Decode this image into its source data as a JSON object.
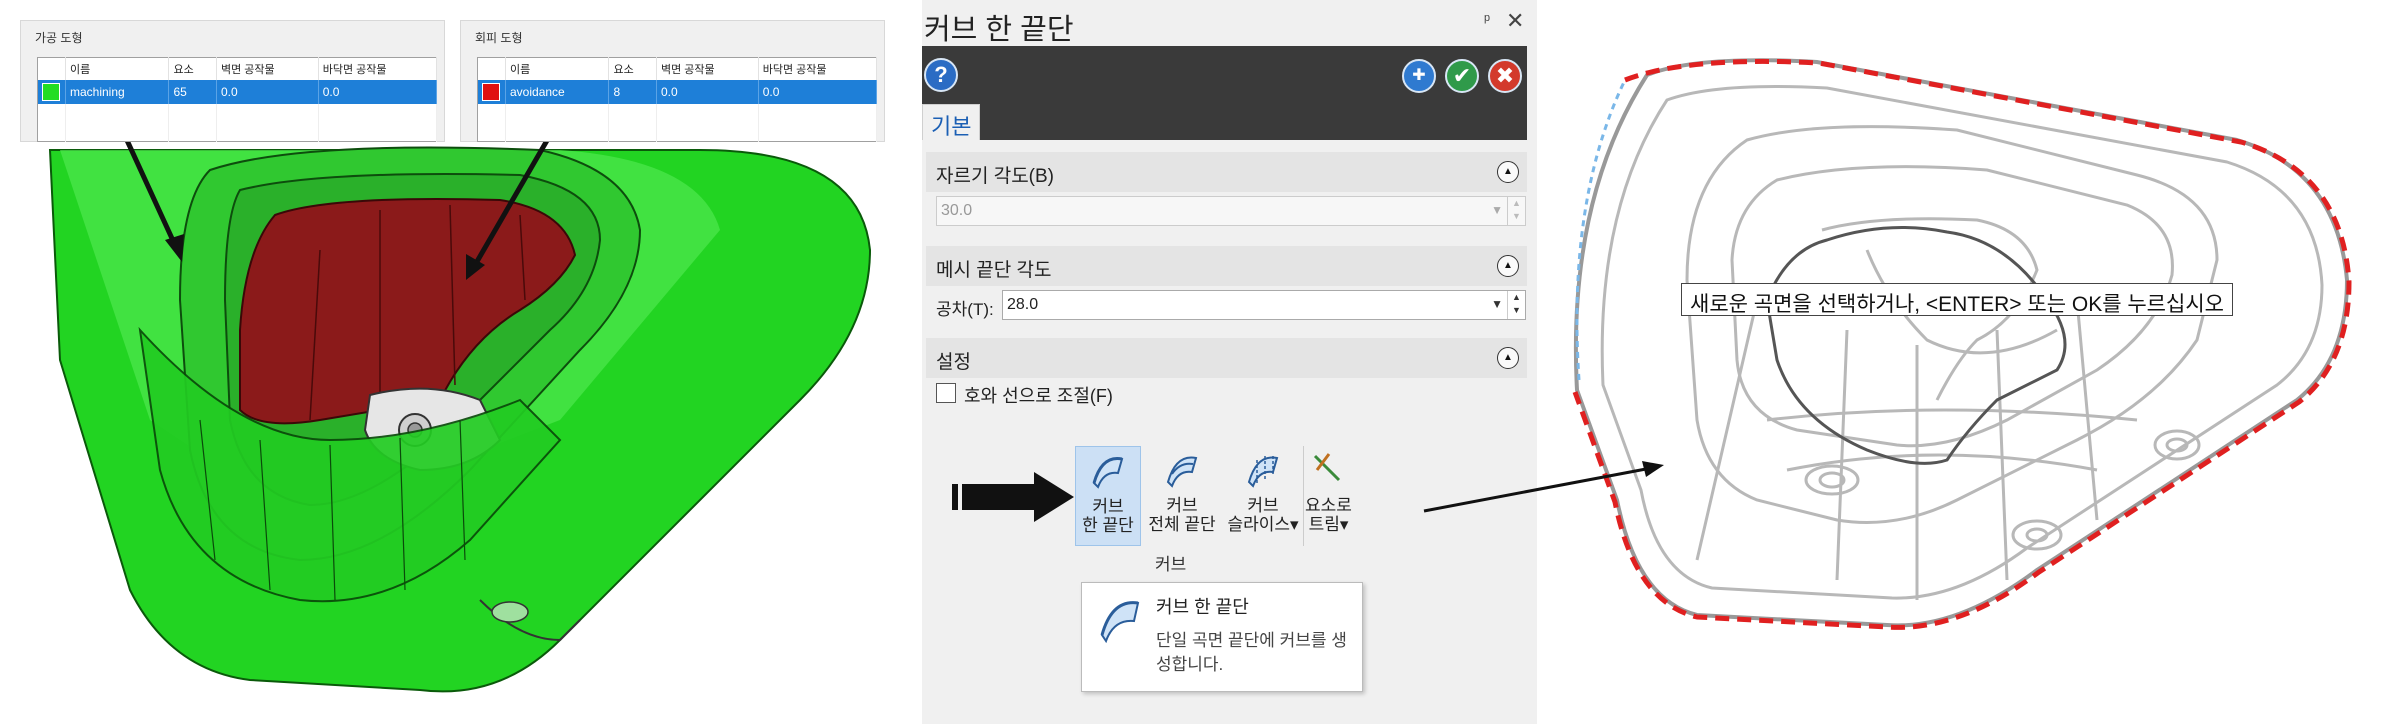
{
  "machining_panel": {
    "title": "가공 도형",
    "columns": [
      "이름",
      "요소",
      "벽면 공작물",
      "바닥면 공작물"
    ],
    "row": {
      "name": "machining",
      "elements": "65",
      "wall_stock": "0.0",
      "floor_stock": "0.0",
      "color": "#22dd22"
    }
  },
  "avoidance_panel": {
    "title": "회피 도형",
    "columns": [
      "이름",
      "요소",
      "벽면 공작물",
      "바닥면 공작물"
    ],
    "row": {
      "name": "avoidance",
      "elements": "8",
      "wall_stock": "0.0",
      "floor_stock": "0.0",
      "color": "#e01010"
    }
  },
  "dialog": {
    "title": "커브 한 끝단",
    "pin_icon": "pin-icon",
    "close_icon": "close-icon",
    "help_icon": "help-icon",
    "apply_icon": "apply-icon",
    "ok_icon": "ok-icon",
    "cancel_icon": "cancel-icon",
    "tab": "기본",
    "sections": {
      "cut_angle": {
        "header": "자르기 각도(B)",
        "value": "30.0"
      },
      "mesh_edge_angle": {
        "header": "메시 끝단 각도",
        "tolerance_label": "공차(T):",
        "tolerance_value": "28.0"
      },
      "settings": {
        "header": "설정",
        "checkbox_label": "호와 선으로 조절(F)",
        "checked": false
      }
    }
  },
  "ribbon": {
    "buttons": [
      {
        "line1": "커브",
        "line2": "한 끝단"
      },
      {
        "line1": "커브",
        "line2": "전체 끝단"
      },
      {
        "line1": "커브",
        "line2": "슬라이스▾"
      },
      {
        "line1": "요소로",
        "line2": "트림▾"
      }
    ],
    "group_label": "커브"
  },
  "tooltip": {
    "title": "커브 한 끝단",
    "description": "단일 곡면 끝단에 커브를 생성합니다."
  },
  "prompt": {
    "text": "새로운 곡면을 선택하거나, <ENTER> 또는 OK를 누르십시오"
  },
  "colors": {
    "machining_green": "#22dd22",
    "avoidance_red": "#8b1a1a",
    "selection_blue": "#1e7fd8",
    "dashed_edge_red": "#e02020"
  }
}
